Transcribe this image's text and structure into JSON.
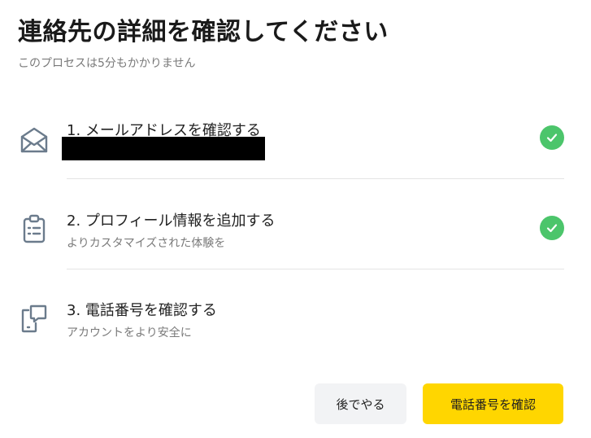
{
  "header": {
    "title": "連絡先の詳細を確認してください",
    "subtitle": "このプロセスは5分もかかりません"
  },
  "steps": [
    {
      "title": "1. メールアドレスを確認する",
      "subtitle": "",
      "icon": "envelope-open-icon",
      "completed": true
    },
    {
      "title": "2. プロフィール情報を追加する",
      "subtitle": "よりカスタマイズされた体験を",
      "icon": "clipboard-list-icon",
      "completed": true
    },
    {
      "title": "3. 電話番号を確認する",
      "subtitle": "アカウントをより安全に",
      "icon": "phone-chat-icon",
      "completed": false
    }
  ],
  "buttons": {
    "later_label": "後でやる",
    "confirm_label": "電話番号を確認"
  },
  "colors": {
    "accent": "#ffd600",
    "success": "#4cc56b",
    "icon": "#6b7b8c"
  }
}
